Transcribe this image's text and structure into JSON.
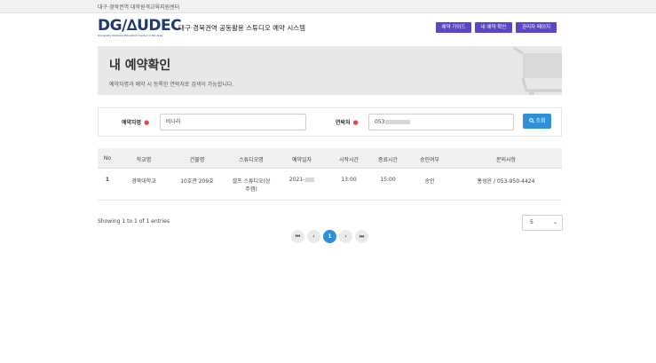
{
  "topbar": {
    "org": "대구·경북권역 대학원격교육지원센터"
  },
  "header": {
    "logo_main": "DG∕∆UDEC",
    "logo_sub": "University Distance Education Center in DG Area",
    "site_title": "대구·경북권역 공동활용 스튜디오 예약 시스템",
    "nav": [
      "예약 가이드",
      "내 예약 확인",
      "관리자 페이지"
    ]
  },
  "banner": {
    "title": "내 예약확인",
    "description": "예약자명과 예약 시 등록한 연락처로 검색이 가능합니다."
  },
  "search": {
    "name_label": "예약자명",
    "name_value": "비나라",
    "phone_label": "연락처",
    "phone_value": "053",
    "button_label": "조회",
    "required_mark": "●"
  },
  "table": {
    "headers": [
      "No",
      "학교명",
      "건물명",
      "스튜디오명",
      "예약일자",
      "시작시간",
      "종료시간",
      "승인여부",
      "문의사항"
    ],
    "rows": [
      {
        "no": "1",
        "school": "경북대학교",
        "building": "10호관 209호",
        "studio_line1": "셀프 스튜디오(상",
        "studio_line2": "주캠)",
        "date": "2021-",
        "start": "13:00",
        "end": "15:00",
        "status": "승인",
        "contact": "홍성윤 / 053-950-4424"
      }
    ]
  },
  "footer": {
    "entries_text": "Showing 1 to 1 of 1 entries",
    "page_size": "5",
    "current_page": "1"
  },
  "colors": {
    "nav_bg": "#5b46c6",
    "primary": "#2f8fd8",
    "logo": "#1f3a73",
    "required": "#e24646"
  }
}
